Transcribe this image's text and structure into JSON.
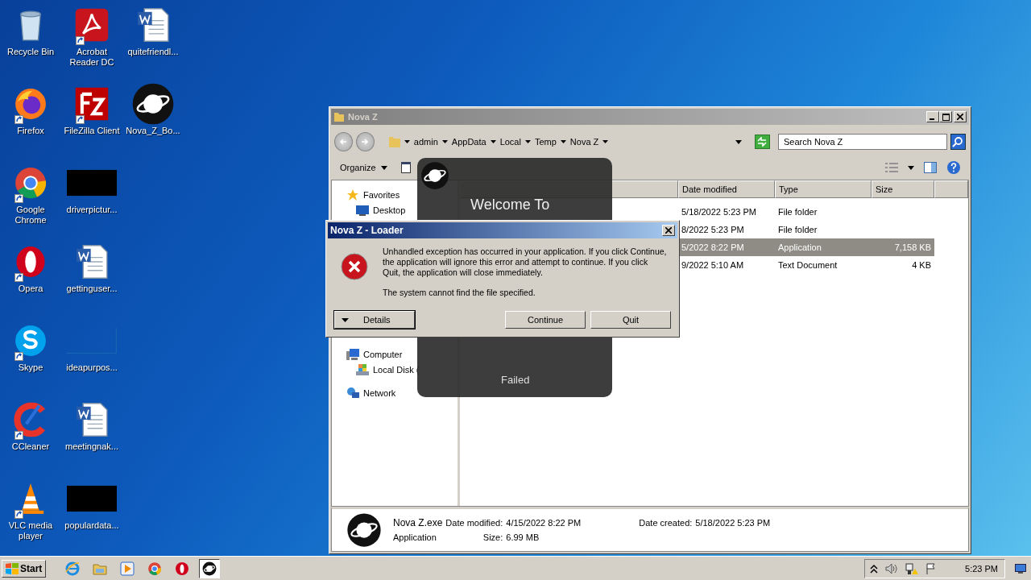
{
  "desktop_icons": [
    {
      "label": "Recycle Bin",
      "kind": "recycle",
      "shortcut": false
    },
    {
      "label": "Firefox",
      "kind": "firefox",
      "shortcut": true
    },
    {
      "label": "Google Chrome",
      "kind": "chrome",
      "shortcut": true
    },
    {
      "label": "Opera",
      "kind": "opera",
      "shortcut": true
    },
    {
      "label": "Skype",
      "kind": "skype",
      "shortcut": true
    },
    {
      "label": "CCleaner",
      "kind": "ccleaner",
      "shortcut": true
    },
    {
      "label": "VLC media player",
      "kind": "vlc",
      "shortcut": true
    },
    {
      "label": "Acrobat Reader DC",
      "kind": "acrobat",
      "shortcut": true
    },
    {
      "label": "FileZilla Client",
      "kind": "filezilla",
      "shortcut": true
    },
    {
      "label": "driverpictur...",
      "kind": "thumbnail",
      "shortcut": false
    },
    {
      "label": "gettinguser...",
      "kind": "word",
      "shortcut": false
    },
    {
      "label": "ideapurpos...",
      "kind": "blank",
      "shortcut": false
    },
    {
      "label": "meetingnak...",
      "kind": "word",
      "shortcut": false
    },
    {
      "label": "populardata...",
      "kind": "thumbnail",
      "shortcut": false
    },
    {
      "label": "quitefriendl...",
      "kind": "word",
      "shortcut": false
    },
    {
      "label": "Nova_Z_Bo...",
      "kind": "nova",
      "shortcut": false
    }
  ],
  "explorer": {
    "title": "Nova Z",
    "breadcrumbs": [
      "admin",
      "AppData",
      "Local",
      "Temp",
      "Nova Z"
    ],
    "search": {
      "placeholder": "Search Nova Z"
    },
    "toolbar": [
      {
        "label": "Organize",
        "kind": "menu"
      }
    ],
    "nav": [
      {
        "label": "Favorites",
        "kind": "favorites",
        "children": [
          {
            "label": "Desktop",
            "kind": "desktop"
          }
        ]
      },
      {
        "label": "Computer",
        "kind": "computer",
        "children": [
          {
            "label": "Local Disk (",
            "kind": "disk"
          }
        ]
      },
      {
        "label": "Network",
        "kind": "network"
      }
    ],
    "columns": [
      "Date modified",
      "Type",
      "Size"
    ],
    "rows": [
      {
        "date": "5/18/2022 5:23 PM",
        "type": "File folder",
        "selected": false
      },
      {
        "date": "8/2022 5:23 PM",
        "type": "File folder",
        "selected": false
      },
      {
        "date": "5/2022 8:22 PM",
        "type": "Application",
        "size": "7,158 KB",
        "selected": true
      },
      {
        "date": "9/2022 5:10 AM",
        "type": "Text Document",
        "size": "4 KB",
        "selected": false
      }
    ],
    "details": {
      "name": "Nova Z.exe",
      "type": "Application",
      "modified_label": "Date modified:",
      "modified": "4/15/2022 8:22 PM",
      "created_label": "Date created:",
      "created": "5/18/2022 5:23 PM",
      "size_label": "Size:",
      "size": "6.99 MB"
    }
  },
  "splash": {
    "title": "Welcome To",
    "status": "Failed"
  },
  "dialog": {
    "title": "Nova Z - Loader",
    "message": "Unhandled exception has occurred in your application. If you click Continue, the application will ignore this error and attempt to continue. If you click Quit, the application will close immediately.",
    "detail": "The system cannot find the file specified.",
    "buttons": [
      {
        "label": "Details",
        "kind": "expander"
      },
      {
        "label": "Continue",
        "kind": "plain"
      },
      {
        "label": "Quit",
        "kind": "plain"
      }
    ]
  },
  "taskbar": {
    "start": "Start",
    "apps": [
      {
        "kind": "ie",
        "active": false
      },
      {
        "kind": "explorer",
        "active": false
      },
      {
        "kind": "media",
        "active": false
      },
      {
        "kind": "chrome",
        "active": false
      },
      {
        "kind": "opera",
        "active": false
      },
      {
        "kind": "nova",
        "active": true
      }
    ],
    "clock": "5:23 PM"
  }
}
